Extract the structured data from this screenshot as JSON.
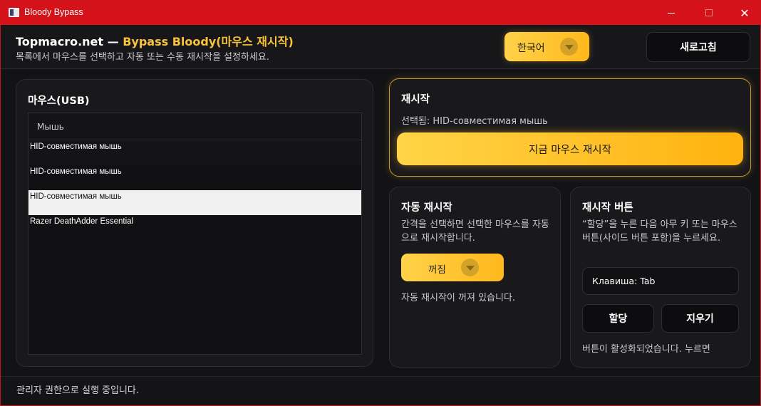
{
  "window": {
    "title": "Bloody Bypass",
    "minimize_label": "",
    "maximize_label": "",
    "close_label": "✕"
  },
  "header": {
    "brand": "Topmacro.net",
    "separator": "—",
    "product": "Bypass Bloody(마우스 재시작)",
    "subtitle": "목록에서 마우스를 선택하고 자동 또는 수동 재시작을 설정하세요.",
    "language": "한국어",
    "refresh_label": "새로고침"
  },
  "mouse_panel": {
    "title": "마우스(USB)",
    "column_header": "Мышь",
    "devices": [
      "HID-совместимая мышь",
      "HID-совместимая мышь",
      "HID-совместимая мышь",
      "Razer DeathAdder Essential"
    ],
    "selected_index": 2
  },
  "restart_panel": {
    "title": "재시작",
    "selected_text": "선택됨: HID-совместимая мышь",
    "restart_now_label": "지금 마우스 재시작"
  },
  "auto_panel": {
    "title": "자동 재시작",
    "description": "간격을 선택하면 선택한 마우스를 자동으로 재시작합니다.",
    "interval_value": "꺼짐",
    "status": "자동 재시작이 꺼져 있습니다."
  },
  "button_panel": {
    "title": "재시작 버튼",
    "description": "“할당”을 누른 다음 아무 키 또는 마우스 버튼(사이드 버튼 포함)을 누르세요.",
    "key_value": "Клавиша: Tab",
    "assign_label": "할당",
    "clear_label": "지우기",
    "status": "버튼이 활성화되었습니다. 누르면"
  },
  "footer": {
    "status": "관리자 권한으로 실행 중입니다."
  },
  "colors": {
    "titlebar": "#d5121a",
    "accent": "#ffc42e",
    "accent_text": "#f8c23a",
    "panel_bg": "#19191c",
    "app_bg": "#131316"
  }
}
